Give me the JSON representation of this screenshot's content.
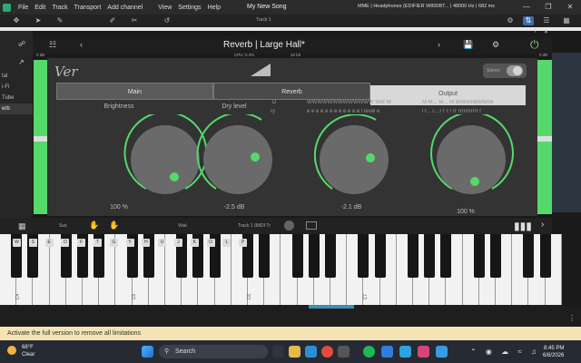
{
  "menubar": {
    "menus": [
      "File",
      "Edit",
      "Track",
      "Transport",
      "Add channel",
      "View",
      "Settings",
      "Help"
    ],
    "song_title": "My New Song",
    "audio_info": "MME | Headphones (EDIFIER W800BT... | 48000 Hz | 682 ms"
  },
  "toolbar": {
    "track_label": "Track 1"
  },
  "tracklist": {
    "items": [
      "tal",
      "i-Fi",
      "Tube",
      "erb"
    ]
  },
  "plugin": {
    "preset_prefix": "Reverb |",
    "preset_name": "Large Hall*",
    "cpu": "CPU: 0.3%",
    "bits": "32 bit",
    "meter_left_label": "0 dB",
    "meter_right_label": "0 dB",
    "logo": "Ver",
    "stereo_label": "Stereo",
    "tabs": [
      {
        "label": "Main"
      },
      {
        "label": "Reverb"
      },
      {
        "label": "Output"
      }
    ],
    "knobs": [
      {
        "label": "Brightness",
        "value": "100 %"
      },
      {
        "label": "Dry level",
        "value": "-2.5 dB"
      },
      {
        "label": "",
        "value": "-2.1 dB"
      },
      {
        "label": "",
        "value": "100 %"
      }
    ],
    "garbled": {
      "k2_right": "D",
      "k2_right2": "ry",
      "k3_top": "WWWWWWWWWWWWW  Wet  W",
      "k3_sub": "e e e e e e e e e e e e l  level  e",
      "k4_top": "M M... M... M M\\M\\M\\MMM\\M",
      "k4_sub": "l  r... l... r  r r  r  rr rrrrrrrrrrr r"
    }
  },
  "pianobar": {
    "sus": "Sus",
    "vel": "Vital",
    "midi": "Track 1 (MIDI Tr"
  },
  "keyboard": {
    "key_labels": [
      "W",
      "S",
      "E",
      "D",
      "F",
      "T",
      "G",
      "Y",
      "H",
      "U",
      "J",
      "K",
      "O",
      "L",
      "P"
    ],
    "octaves": [
      "C3",
      "C4",
      "C5",
      "C6",
      "C7"
    ]
  },
  "notice": {
    "text": "Activate the full version to remove all limitations"
  },
  "taskbar": {
    "temp": "68°F",
    "weather": "Clear",
    "search": "Search",
    "time": "8:45 PM",
    "date": "6/8/2026"
  },
  "colors": {
    "accent": "#55d96a",
    "knob": "#6a6a6a",
    "notice_bg": "#f5e3b3"
  }
}
